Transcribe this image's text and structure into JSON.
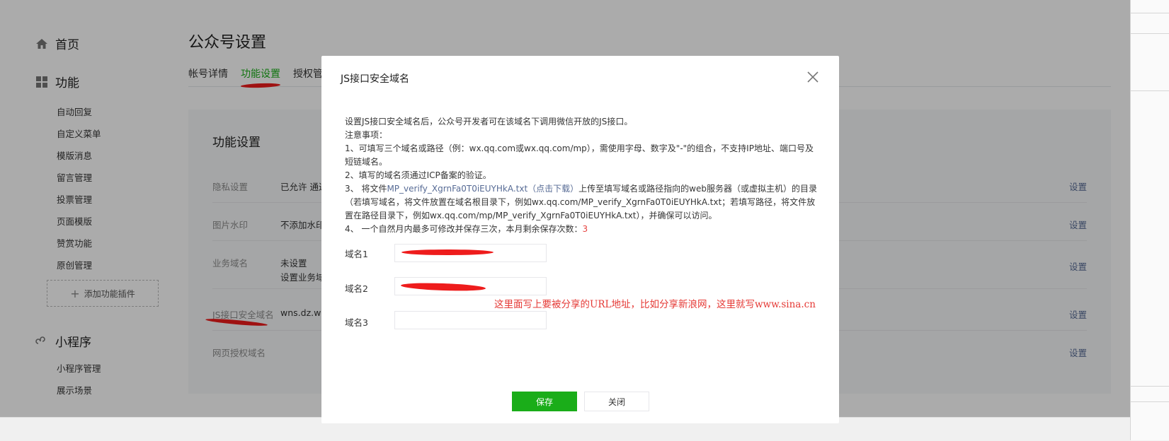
{
  "sidebar": {
    "home": "首页",
    "features_header": "功能",
    "features": [
      "自动回复",
      "自定义菜单",
      "模版消息",
      "留言管理",
      "投票管理",
      "页面模版",
      "赞赏功能",
      "原创管理"
    ],
    "add_plugin": "添加功能插件",
    "miniprogram_header": "小程序",
    "miniprogram": [
      "小程序管理",
      "展示场景"
    ]
  },
  "page": {
    "title": "公众号设置",
    "tabs": [
      "帐号详情",
      "功能设置",
      "授权管"
    ],
    "active_tab": "功能设置"
  },
  "panel": {
    "title": "功能设置",
    "rows": [
      {
        "label": "隐私设置",
        "value": "已允许 通过",
        "value2": "",
        "action": "设置"
      },
      {
        "label": "图片水印",
        "value": "不添加水印",
        "value2": "",
        "action": "设置"
      },
      {
        "label": "业务域名",
        "value": "未设置",
        "value2": "设置业务域",
        "action": "设置"
      },
      {
        "label": "JS接口安全域名",
        "value": "wns.dz.we",
        "value2": "",
        "action": "设置"
      },
      {
        "label": "网页授权域名",
        "value": "",
        "value2": "",
        "action": "设置"
      }
    ]
  },
  "dialog": {
    "title": "JS接口安全域名",
    "intro": "设置JS接口安全域名后，公众号开发者可在该域名下调用微信开放的JS接口。",
    "notes_header": "注意事项：",
    "note1": "1、可填写三个域名或路径（例：wx.qq.com或wx.qq.com/mp），需使用字母、数字及\"-\"的组合，不支持IP地址、端口号及短链域名。",
    "note2": "2、填写的域名须通过ICP备案的验证。",
    "note3_prefix": "3、 将文件",
    "note3_file": "MP_verify_XgrnFa0T0iEUYHkA.txt",
    "note3_download": "（点击下载）",
    "note3_suffix": "上传至填写域名或路径指向的web服务器（或虚拟主机）的目录（若填写域名，将文件放置在域名根目录下，例如wx.qq.com/MP_verify_XgrnFa0T0iEUYHkA.txt；若填写路径，将文件放置在路径目录下，例如wx.qq.com/mp/MP_verify_XgrnFa0T0iEUYHkA.txt），并确保可以访问。",
    "note4_prefix": "4、 一个自然月内最多可修改并保存三次，本月剩余保存次数：",
    "note4_count": "3",
    "fields": [
      {
        "label": "域名1",
        "value": ""
      },
      {
        "label": "域名2",
        "value": ""
      },
      {
        "label": "域名3",
        "value": ""
      }
    ],
    "annotation": "这里面写上要被分享的URL地址，比如分享新浪网，这里就写www.sina.cn",
    "save": "保存",
    "close": "关闭"
  },
  "colors": {
    "accent": "#1aad19",
    "link": "#576b95",
    "warning_red": "#e64340",
    "annotation_red": "#ee1c1c"
  }
}
